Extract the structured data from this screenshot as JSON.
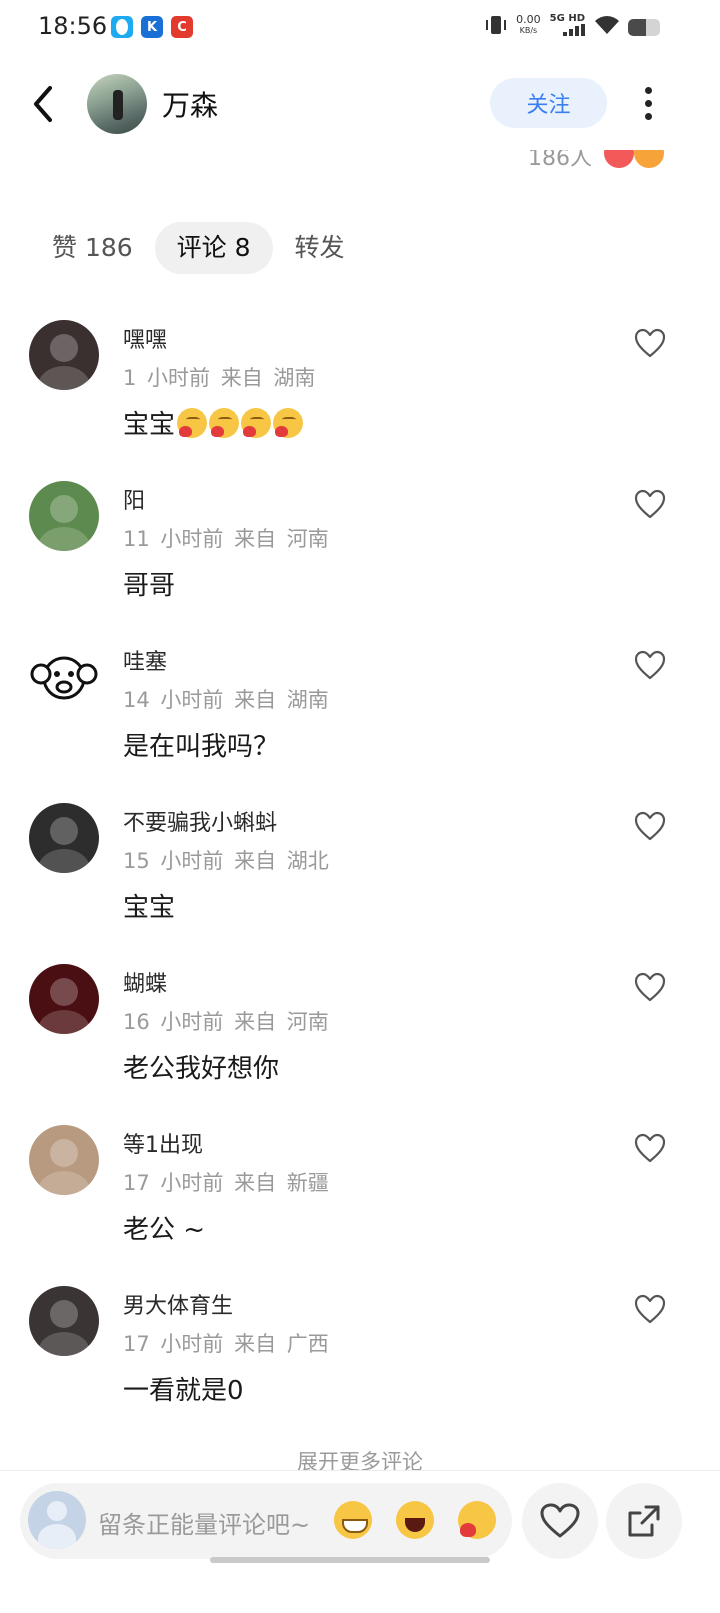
{
  "status_bar": {
    "time": "18:56",
    "net_speed": "0.00",
    "net_unit": "KB/s",
    "network": "5G HD",
    "battery_level": 0.55
  },
  "header": {
    "username": "万森",
    "follow_label": "关注",
    "back_icon": "chevron-left-icon",
    "more_icon": "more-vertical-icon"
  },
  "like_peek": {
    "count_text": "186人"
  },
  "tabs": [
    {
      "label": "赞 186",
      "active": false
    },
    {
      "label": "评论 8",
      "active": true
    },
    {
      "label": "转发",
      "active": false
    }
  ],
  "comments": [
    {
      "name": "嘿嘿",
      "time": "1 小时前",
      "from": "来自",
      "region": "湖南",
      "text": "宝宝",
      "emojis": 4,
      "avatar_color": "#3b3030"
    },
    {
      "name": "阳",
      "time": "11 小时前",
      "from": "来自",
      "region": "河南",
      "text": "哥哥",
      "emojis": 0,
      "avatar_color": "#5d8a4e"
    },
    {
      "name": "哇塞",
      "time": "14 小时前",
      "from": "来自",
      "region": "湖南",
      "text": "是在叫我吗？",
      "emojis": 0,
      "avatar_color": "#ffffff"
    },
    {
      "name": "不要骗我小蝌蚪",
      "time": "15 小时前",
      "from": "来自",
      "region": "湖北",
      "text": "宝宝",
      "emojis": 0,
      "avatar_color": "#2d2d2d"
    },
    {
      "name": "蝴蝶",
      "time": "16 小时前",
      "from": "来自",
      "region": "河南",
      "text": "老公我好想你",
      "emojis": 0,
      "avatar_color": "#4a0f12"
    },
    {
      "name": "等1出现",
      "time": "17 小时前",
      "from": "来自",
      "region": "新疆",
      "text": "老公 ~",
      "emojis": 0,
      "avatar_color": "#b89a80"
    },
    {
      "name": "男大体育生",
      "time": "17 小时前",
      "from": "来自",
      "region": "广西",
      "text": "一看就是0",
      "emojis": 0,
      "avatar_color": "#3a3434"
    }
  ],
  "expand_more": "展开更多评论",
  "bottom_bar": {
    "placeholder": "留条正能量评论吧~",
    "emoji_icons": [
      "grin-emoji-icon",
      "laugh-emoji-icon",
      "heart-emoji-icon"
    ],
    "like_icon": "heart-outline-icon",
    "share_icon": "share-icon"
  },
  "colors": {
    "accent": "#3a7ff0",
    "follow_bg": "#e9f1fd",
    "meta_gray": "#9a9a9a"
  }
}
